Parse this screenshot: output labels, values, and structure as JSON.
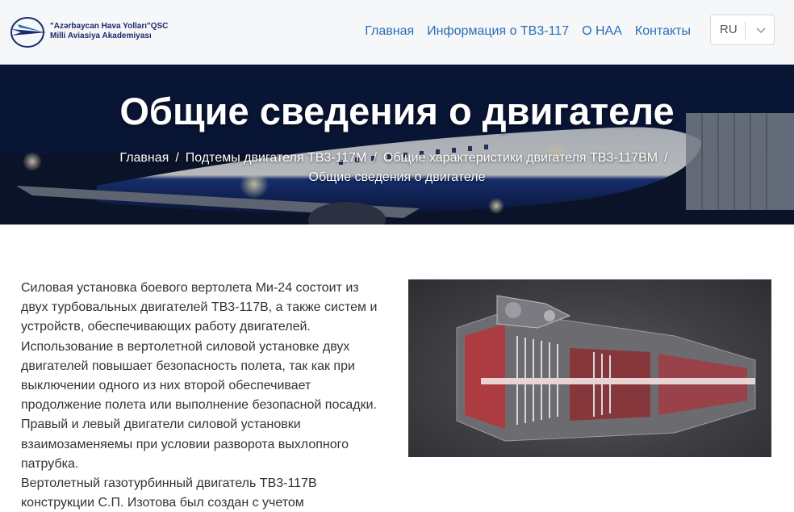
{
  "logo": {
    "line1": "\"Azərbaycan Hava Yolları\"QSC",
    "line2": "Milli Aviasiya Akademiyası"
  },
  "nav": {
    "items": [
      {
        "label": "Главная"
      },
      {
        "label": "Информация о ТВ3-117"
      },
      {
        "label": "О НАА"
      },
      {
        "label": "Контакты"
      }
    ]
  },
  "language": {
    "selected": "RU"
  },
  "hero": {
    "title": "Общие сведения о двигателе",
    "breadcrumbs": [
      "Главная",
      "Подтемы двигателя ТВ3-117М",
      "Общие характеристики двигателя ТВ3-117ВМ",
      "Общие сведения о двигателе"
    ],
    "separator": "/"
  },
  "content": {
    "paragraph1": "Силовая установка боевого вертолета Ми-24 состоит из двух турбовальных двигателей ТВ3-117В, а также систем и устройств, обеспечивающих работу двигателей. Использование в вертолетной силовой установке двух двигателей повышает безопасность полета, так как при выключении одного из них второй обеспечивает продолжение полета или выполнение безопасной посадки. Правый и левый двигатели силовой установки взаимозаменяемы при условии разворота выхлопного патрубка.",
    "paragraph2": "Вертолетный газотурбинный двигатель ТВ3-117В конструкции С.П. Изотова был создан с учетом"
  },
  "colors": {
    "link": "#2a6fb5",
    "brand": "#1a2a6c",
    "hero": "#12255a"
  }
}
